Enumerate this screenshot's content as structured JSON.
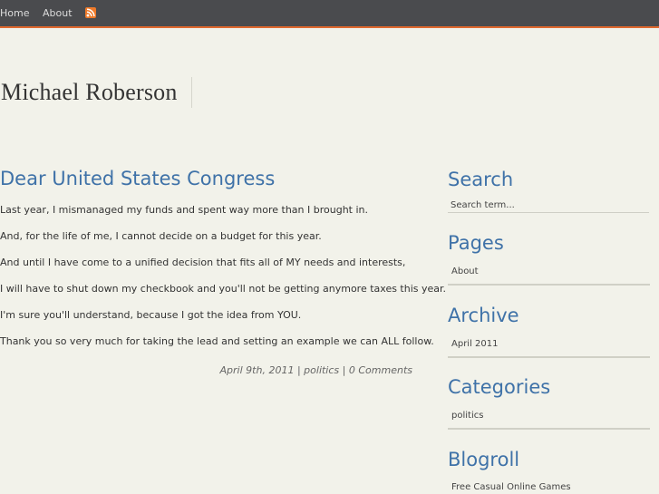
{
  "nav": {
    "home": "Home",
    "about": "About",
    "rss_icon": "rss-icon",
    "accent_color": "#e0682e"
  },
  "site": {
    "title": "Michael Roberson"
  },
  "post": {
    "title": "Dear United States Congress",
    "paragraphs": [
      "Last year, I mismanaged my funds and spent way more than I brought in.",
      "And, for the life of me, I cannot decide on a budget for this year.",
      "And until I have come to a unified decision that fits all of MY needs and interests,",
      "I will have to shut down my checkbook and you'll not be getting anymore taxes this year.",
      "I'm sure you'll understand, because I got the idea from YOU.",
      "Thank you so very much for taking the lead and setting an example we can ALL follow."
    ],
    "meta": {
      "date": "April 9th, 2011",
      "category": "politics",
      "comments": "0 Comments",
      "separator": "|"
    }
  },
  "sidebar": {
    "search": {
      "title": "Search",
      "placeholder": "Search term..."
    },
    "pages": {
      "title": "Pages",
      "items": [
        "About"
      ]
    },
    "archive": {
      "title": "Archive",
      "items": [
        "April 2011"
      ]
    },
    "categories": {
      "title": "Categories",
      "items": [
        "politics"
      ]
    },
    "blogroll": {
      "title": "Blogroll",
      "items": [
        "Free Casual Online Games"
      ]
    }
  }
}
